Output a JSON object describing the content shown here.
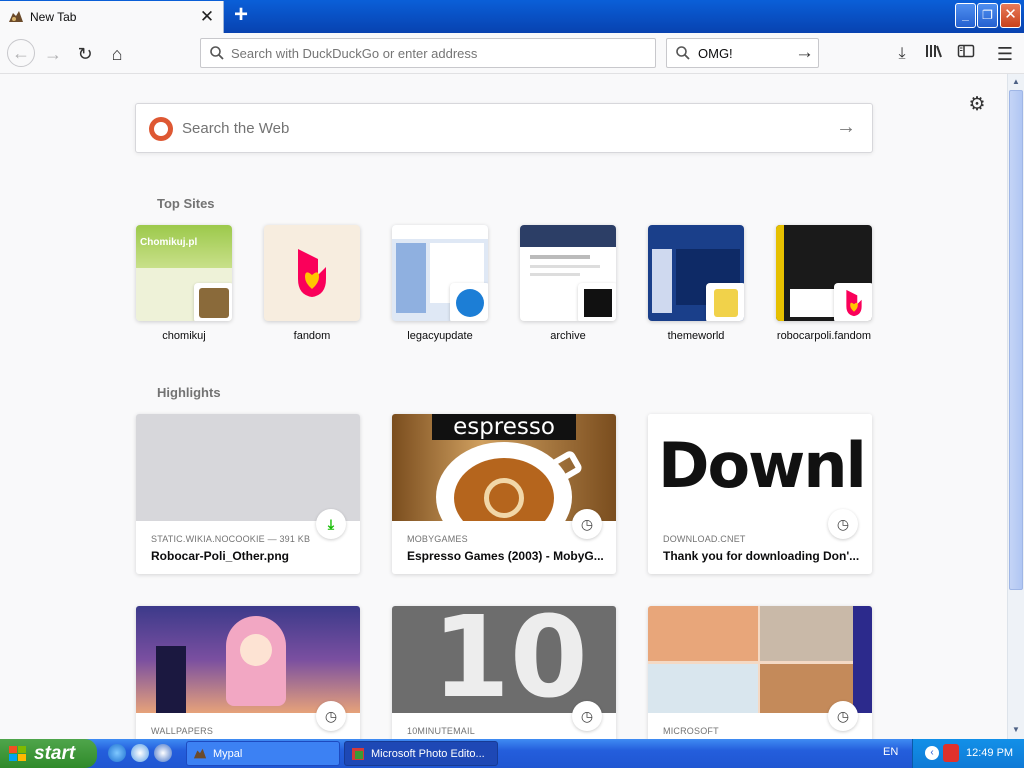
{
  "browser": {
    "tab": {
      "title": "New Tab",
      "close": "✕"
    },
    "new_tab": "+",
    "window_buttons": {
      "minimize": "_",
      "maximize": "❐",
      "close": "✕"
    },
    "url_placeholder": "Search with DuckDuckGo or enter address",
    "search_value": "OMG!"
  },
  "newtab": {
    "web_search_placeholder": "Search the Web",
    "top_sites_title": "Top Sites",
    "highlights_title": "Highlights",
    "top_sites": [
      {
        "label": "chomikuj"
      },
      {
        "label": "fandom"
      },
      {
        "label": "legacyupdate"
      },
      {
        "label": "archive"
      },
      {
        "label": "themeworld"
      },
      {
        "label": "robocarpoli.fandom"
      }
    ],
    "highlights": [
      {
        "source": "STATIC.WIKIA.NOCOOKIE — 391 KB",
        "title": "Robocar-Poli_Other.png",
        "badge": "download-icon"
      },
      {
        "source": "MOBYGAMES",
        "title": "Espresso Games (2003) - MobyG...",
        "badge": "clock-icon"
      },
      {
        "source": "DOWNLOAD.CNET",
        "title": "Thank you for downloading Don'...",
        "badge": "clock-icon"
      },
      {
        "source": "WALLPAPERS",
        "title": "",
        "badge": "clock-icon"
      },
      {
        "source": "10MINUTEMAIL",
        "title": "",
        "badge": "clock-icon"
      },
      {
        "source": "MICROSOFT",
        "title": "",
        "badge": "clock-icon"
      }
    ],
    "thumb_texts": {
      "chomikuj_logo": "Chomikuj.pl",
      "espresso": "espresso",
      "downl": "Downl",
      "ten": "10"
    }
  },
  "taskbar": {
    "start": "start",
    "items": [
      "Mypal",
      "Microsoft Photo Edito..."
    ],
    "lang": "EN",
    "clock": "12:49 PM"
  },
  "colors": {
    "xp_blue": "#245edc",
    "start_green": "#3a9b35",
    "fandom_pink": "#fa005a",
    "accent_green": "#12bc00"
  }
}
